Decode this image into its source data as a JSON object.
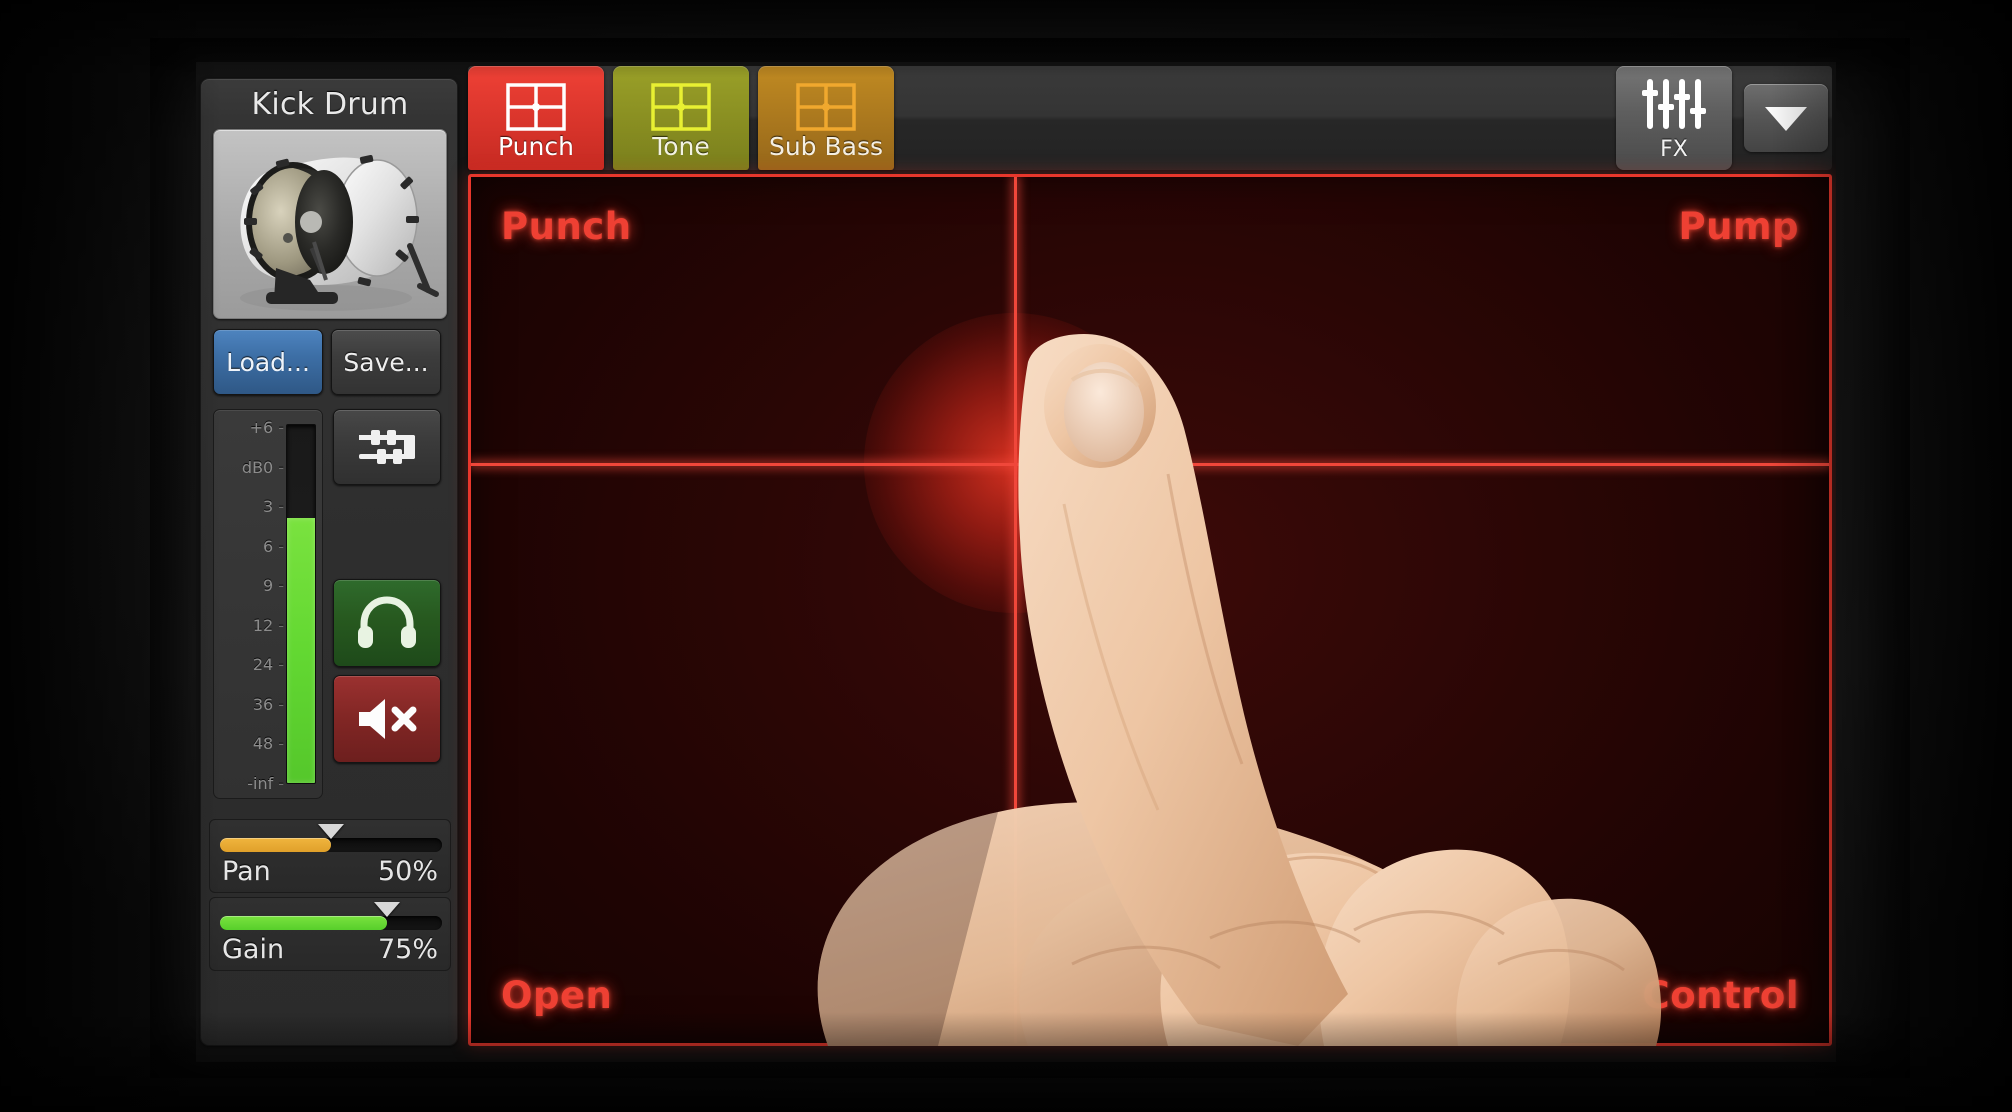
{
  "sidebar": {
    "instrument_title": "Kick Drum",
    "instrument_thumb_icon": "kick-drum-image",
    "load_label": "Load...",
    "save_label": "Save...",
    "mixer_icon": "mixer-sliders-icon",
    "headphones_icon": "headphones-icon",
    "mute_icon": "speaker-mute-icon",
    "meter": {
      "ticks": [
        "+6",
        "dB0",
        "3",
        "6",
        "9",
        "12",
        "24",
        "36",
        "48",
        "-inf"
      ],
      "tick_dash": "-",
      "level_percent": 74,
      "fill_color": "#63d832"
    },
    "sliders": [
      {
        "name": "Pan",
        "value_label": "50%",
        "percent": 50,
        "color": "#e0a02a"
      },
      {
        "name": "Gain",
        "value_label": "75%",
        "percent": 75,
        "color": "#57cf2b"
      }
    ]
  },
  "tabbar": {
    "tabs": [
      {
        "label": "Punch",
        "icon": "xy-grid-icon",
        "active": true,
        "bg_top": "#ef4136",
        "bg_bottom": "#c62a22",
        "icon_color": "#ffffff",
        "label_color": "#ffffff"
      },
      {
        "label": "Tone",
        "icon": "xy-grid-icon",
        "active": false,
        "bg_top": "#9aa028",
        "bg_bottom": "#7a7f1c",
        "icon_color": "#e8f032",
        "label_color": "#f2f2e2"
      },
      {
        "label": "Sub Bass",
        "icon": "xy-grid-icon",
        "active": false,
        "bg_top": "#c08a22",
        "bg_bottom": "#96671a",
        "icon_color": "#f0a82e",
        "label_color": "#f5efe2"
      }
    ],
    "fx_label": "FX",
    "fx_icon": "fx-sliders-icon",
    "dropdown_icon": "chevron-down-icon"
  },
  "xypad": {
    "corners": {
      "top_left": "Punch",
      "top_right": "Pump",
      "bottom_left": "Open",
      "bottom_right": "Control"
    },
    "cursor": {
      "x_percent": 40,
      "y_percent": 33
    },
    "accent_color": "#ee4033",
    "touch_indicator": "finger-touch-glow"
  }
}
